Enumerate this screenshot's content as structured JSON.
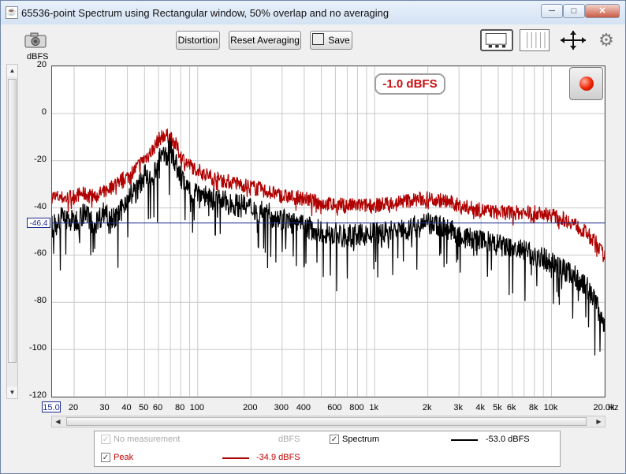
{
  "window": {
    "title": "65536-point Spectrum using Rectangular window, 50% overlap and no averaging",
    "app_icon": "java-icon",
    "controls": {
      "minimize": "─",
      "maximize": "□",
      "close": "✕"
    }
  },
  "toolbar": {
    "distortion_label": "Distortion",
    "reset_averaging_label": "Reset Averaging",
    "save_label": "Save",
    "icons": [
      "camera-icon",
      "graph-view-icon",
      "bar-graph-icon",
      "axis-arrows-icon",
      "gear-icon"
    ]
  },
  "plot": {
    "y_unit": "dBFS",
    "x_unit": "Hz",
    "cursor_level": "-46.4",
    "freq_start": "15.0",
    "peak_indicator": "-1.0 dBFS",
    "colors": {
      "spectrum": "#000000",
      "peak": "#b00000",
      "cursor": "#1a2a8c",
      "grid": "#c8c8c8"
    }
  },
  "chart_data": {
    "type": "line",
    "title": "",
    "xlabel": "Hz",
    "ylabel": "dBFS",
    "x_scale": "log",
    "xlim": [
      15,
      20000
    ],
    "ylim": [
      -120,
      20
    ],
    "x_tick_labels": [
      "20",
      "30",
      "40",
      "50",
      "60",
      "80",
      "100",
      "200",
      "300",
      "400",
      "600",
      "800",
      "1k",
      "2k",
      "3k",
      "4k",
      "5k",
      "6k",
      "8k",
      "10k",
      "20.0k"
    ],
    "x_tick_values": [
      20,
      30,
      40,
      50,
      60,
      80,
      100,
      200,
      300,
      400,
      600,
      800,
      1000,
      2000,
      3000,
      4000,
      5000,
      6000,
      8000,
      10000,
      20000
    ],
    "y_ticks": [
      20,
      0,
      -20,
      -40,
      -60,
      -80,
      -100,
      -120
    ],
    "cursor_line_y": -46.4,
    "grid": true,
    "series": [
      {
        "name": "Peak",
        "color": "#b00000",
        "x": [
          15,
          18,
          22,
          26,
          30,
          35,
          40,
          45,
          50,
          55,
          60,
          65,
          70,
          75,
          80,
          90,
          100,
          120,
          150,
          200,
          250,
          300,
          400,
          500,
          700,
          1000,
          1500,
          2000,
          2500,
          3000,
          4000,
          5000,
          6000,
          8000,
          10000,
          13000,
          16000,
          18000,
          20000
        ],
        "y": [
          -35,
          -36,
          -34,
          -35,
          -33,
          -29,
          -27,
          -23,
          -19,
          -16,
          -11,
          -9,
          -10,
          -13,
          -18,
          -22,
          -24,
          -27,
          -29,
          -31,
          -33,
          -35,
          -36,
          -38,
          -39,
          -39,
          -37,
          -36,
          -37,
          -39,
          -41,
          -42,
          -42,
          -42,
          -43,
          -46,
          -51,
          -55,
          -61
        ]
      },
      {
        "name": "Spectrum",
        "color": "#000000",
        "x": [
          15,
          17,
          20,
          23,
          26,
          30,
          35,
          40,
          45,
          50,
          55,
          60,
          65,
          70,
          75,
          80,
          90,
          100,
          120,
          150,
          200,
          250,
          300,
          400,
          500,
          700,
          1000,
          1500,
          2000,
          2500,
          3000,
          4000,
          5000,
          6000,
          8000,
          10000,
          13000,
          16000,
          18000,
          20000
        ],
        "y": [
          -48,
          -44,
          -46,
          -42,
          -47,
          -41,
          -45,
          -35,
          -33,
          -26,
          -30,
          -20,
          -18,
          -15,
          -21,
          -27,
          -33,
          -33,
          -36,
          -38,
          -40,
          -42,
          -45,
          -48,
          -50,
          -52,
          -51,
          -49,
          -47,
          -48,
          -52,
          -54,
          -56,
          -57,
          -60,
          -63,
          -68,
          -74,
          -80,
          -90
        ]
      }
    ]
  },
  "legend": {
    "no_measurement_label": "No measurement",
    "no_measurement_unit": "dBFS",
    "spectrum_label": "Spectrum",
    "spectrum_value": "-53.0 dBFS",
    "peak_label": "Peak",
    "peak_value": "-34.9 dBFS",
    "check_mark": "✓"
  }
}
